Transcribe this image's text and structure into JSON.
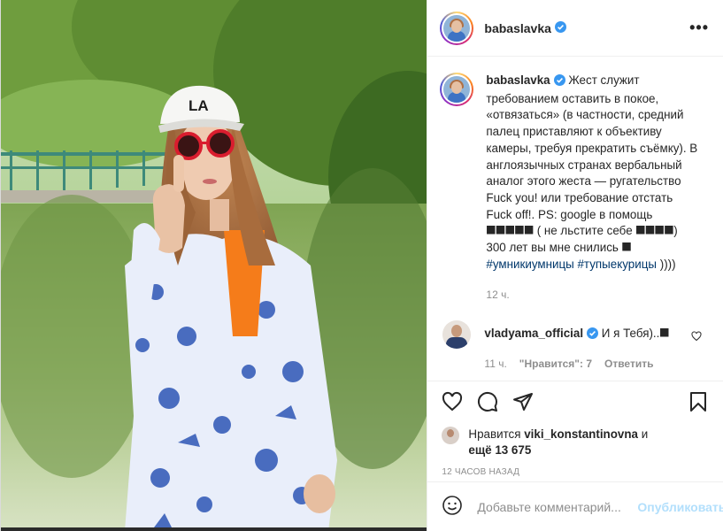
{
  "post": {
    "username": "babaslavka",
    "caption": {
      "username": "babaslavka",
      "text": "Жест служит требованием оставить в покое, «отвязаться» (в частности, средний палец приставляют к объективу камеры, требуя прекратить съёмку). В англоязычных странах вербальный аналог этого жеста — ругательство Fuck you! или требование отстать Fuck off!. PS: google в помощь ⯀⯀⯀⯀⯀ ( не льстите себе ⯀⯀⯀⯀) 300 лет вы мне снились ⯀ ",
      "hashtag1": "#умникиумницы",
      "hashtag2": "#тупыекурицы",
      "tail": " ))))",
      "time": "12 ч."
    },
    "comment": {
      "username": "vladyama_official",
      "text": "И я Тебя)..⯀",
      "time": "11 ч.",
      "likes": "\"Нравится\": 7",
      "reply": "Ответить"
    },
    "likes": {
      "prefix": "Нравится",
      "user": "viki_konstantinovna",
      "and": "и",
      "more": "ещё 13 675"
    },
    "date": "12 ЧАСОВ НАЗАД",
    "add_comment_placeholder": "Добавьте комментарий...",
    "publish_label": "Опубликовать"
  },
  "icons": {
    "more": "more-horizontal-icon",
    "like": "heart-icon",
    "comment": "comment-icon",
    "share": "share-icon",
    "save": "bookmark-icon",
    "emoji": "emoji-icon",
    "verified": "verified-badge-icon"
  },
  "colors": {
    "verified": "#3897f0",
    "link": "#00376b",
    "publish_disabled": "#b2dffc",
    "secondary_text": "#8e8e8e"
  }
}
